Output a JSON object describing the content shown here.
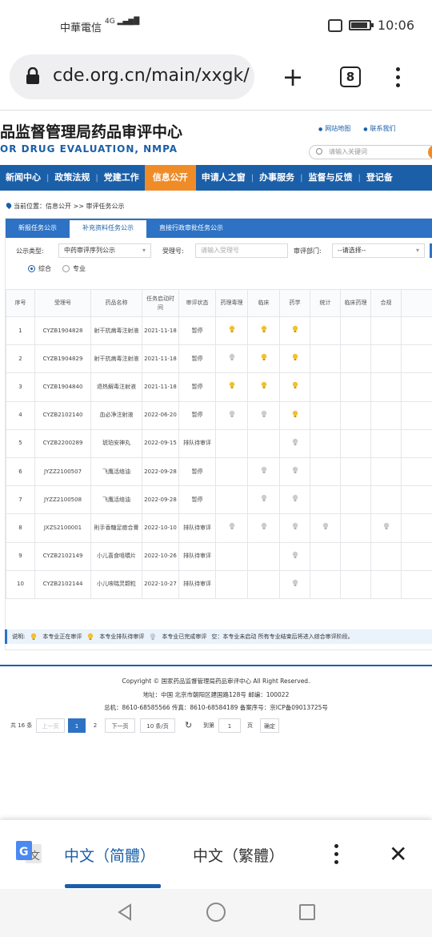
{
  "status": {
    "carrier": "中華電信",
    "net": "4G",
    "time": "10:06"
  },
  "browser": {
    "url": "cde.org.cn/main/xxgk/",
    "tab_count": "8"
  },
  "site": {
    "title_cn": "品监督管理局药品审评中心",
    "title_en": "OR DRUG EVALUATION, NMPA",
    "links": [
      "网站地图",
      "联系我们"
    ],
    "search_placeholder": "请输入关键词"
  },
  "nav": [
    "新闻中心",
    "政策法规",
    "党建工作",
    "信息公开",
    "申请人之窗",
    "办事服务",
    "监督与反馈",
    "登记备"
  ],
  "breadcrumb": "当前位置：信息公开 >> 审评任务公示",
  "tabs": [
    "新报任务公示",
    "补充资料任务公示",
    "直接行政审批任务公示"
  ],
  "filters": {
    "type_label": "公示类型:",
    "type_value": "中药审评序列公示",
    "accept_label": "受理号:",
    "accept_placeholder": "请输入受理号",
    "dept_label": "审评部门:",
    "dept_value": "--请选择--",
    "radio1": "综合",
    "radio2": "专业"
  },
  "table": {
    "headers": [
      "序号",
      "受理号",
      "药品名称",
      "任务启动时间",
      "审评状态",
      "药理毒理",
      "临床",
      "药学",
      "统计",
      "临床药理",
      "合规"
    ],
    "rows": [
      {
        "no": "1",
        "id": "CYZB1904828",
        "name": "射干抗病毒注射液",
        "date": "2021-11-18",
        "status": "暂停",
        "s": [
          "y",
          "y",
          "y",
          "",
          "",
          ""
        ]
      },
      {
        "no": "2",
        "id": "CYZB1904829",
        "name": "射干抗病毒注射液",
        "date": "2021-11-18",
        "status": "暂停",
        "s": [
          "g",
          "y",
          "y",
          "",
          "",
          ""
        ]
      },
      {
        "no": "3",
        "id": "CYZB1904840",
        "name": "退热解毒注射液",
        "date": "2021-11-18",
        "status": "暂停",
        "s": [
          "y",
          "y",
          "y",
          "",
          "",
          ""
        ]
      },
      {
        "no": "4",
        "id": "CYZB2102140",
        "name": "血必净注射液",
        "date": "2022-06-20",
        "status": "暂停",
        "s": [
          "g",
          "g",
          "y",
          "",
          "",
          ""
        ]
      },
      {
        "no": "5",
        "id": "CYZB2200289",
        "name": "琥珀安神丸",
        "date": "2022-09-15",
        "status": "排队待审评",
        "s": [
          "",
          "",
          "g",
          "",
          "",
          ""
        ]
      },
      {
        "no": "6",
        "id": "JYZZ2100507",
        "name": "飞鹰活络油",
        "date": "2022-09-28",
        "status": "暂停",
        "s": [
          "",
          "g",
          "g",
          "",
          "",
          ""
        ]
      },
      {
        "no": "7",
        "id": "JYZZ2100508",
        "name": "飞鹰活络油",
        "date": "2022-09-28",
        "status": "暂停",
        "s": [
          "",
          "g",
          "g",
          "",
          "",
          ""
        ]
      },
      {
        "no": "8",
        "id": "JXZS2100001",
        "name": "則手香糖足癒合膏",
        "date": "2022-10-10",
        "status": "排队待审评",
        "s": [
          "g",
          "g",
          "g",
          "g",
          "",
          "g"
        ]
      },
      {
        "no": "9",
        "id": "CYZB2102149",
        "name": "小儿喜食咀嚼片",
        "date": "2022-10-26",
        "status": "排队待审评",
        "s": [
          "",
          "",
          "g",
          "",
          "",
          ""
        ]
      },
      {
        "no": "10",
        "id": "CYZB2102144",
        "name": "小儿咳喘灵颗粒",
        "date": "2022-10-27",
        "status": "排队待审评",
        "s": [
          "",
          "",
          "g",
          "",
          "",
          ""
        ]
      }
    ]
  },
  "pager": {
    "total": "共 16 条",
    "prev": "上一页",
    "p1": "1",
    "p2": "2",
    "next": "下一页",
    "size": "10 条/页",
    "goto": "到第",
    "page": "1",
    "unit": "页",
    "ok": "确定"
  },
  "legend": {
    "label": "说明:",
    "a": "本专业正在审评",
    "b": "本专业排队待审评",
    "c": "本专业已完成审评",
    "d": "空：本专业未启动  所有专业结束后将进入综合审评阶段。"
  },
  "footer": [
    "Copyright © 国家药品监督管理局药品审评中心  All Right Reserved.",
    "地址：中国 北京市朝阳区建国路128号    邮编：100022",
    "总机：8610-68585566     传真：8610-68584189     备案序号：京ICP备09013725号"
  ],
  "translate": {
    "lang1": "中文（简體）",
    "lang2": "中文（繁體）"
  },
  "colors": {
    "brand": "#1a5fa8",
    "accent": "#f08c28",
    "bulb_active": "#f2c12e",
    "bulb_inactive": "#c9ccd1"
  }
}
